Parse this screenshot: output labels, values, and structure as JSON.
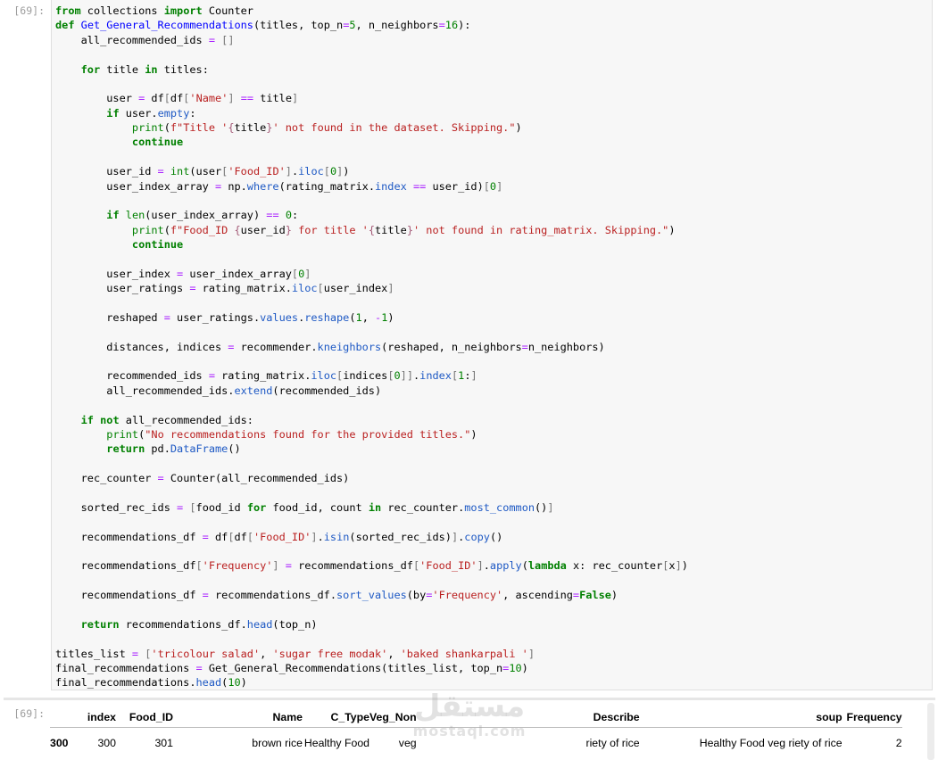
{
  "code_cell": {
    "prompt": "[69]:",
    "lines": [
      "from collections import Counter",
      "def Get_General_Recommendations(titles, top_n=5, n_neighbors=16):",
      "    all_recommended_ids = []",
      "",
      "    for title in titles:",
      "",
      "        user = df[df['Name'] == title]",
      "        if user.empty:",
      "            print(f\"Title '{title}' not found in the dataset. Skipping.\")",
      "            continue",
      "",
      "        user_id = int(user['Food_ID'].iloc[0])",
      "        user_index_array = np.where(rating_matrix.index == user_id)[0]",
      "",
      "        if len(user_index_array) == 0:",
      "            print(f\"Food_ID {user_id} for title '{title}' not found in rating_matrix. Skipping.\")",
      "            continue",
      "",
      "        user_index = user_index_array[0]",
      "        user_ratings = rating_matrix.iloc[user_index]",
      "",
      "        reshaped = user_ratings.values.reshape(1, -1)",
      "",
      "        distances, indices = recommender.kneighbors(reshaped, n_neighbors=n_neighbors)",
      "",
      "        recommended_ids = rating_matrix.iloc[indices[0]].index[1:]",
      "        all_recommended_ids.extend(recommended_ids)",
      "",
      "    if not all_recommended_ids:",
      "        print(\"No recommendations found for the provided titles.\")",
      "        return pd.DataFrame()",
      "",
      "    rec_counter = Counter(all_recommended_ids)",
      "",
      "    sorted_rec_ids = [food_id for food_id, count in rec_counter.most_common()]",
      "",
      "    recommendations_df = df[df['Food_ID'].isin(sorted_rec_ids)].copy()",
      "",
      "    recommendations_df['Frequency'] = recommendations_df['Food_ID'].apply(lambda x: rec_counter[x])",
      "",
      "    recommendations_df = recommendations_df.sort_values(by='Frequency', ascending=False)",
      "",
      "    return recommendations_df.head(top_n)",
      "",
      "titles_list = ['tricolour salad', 'sugar free modak', 'baked shankarpali ']",
      "final_recommendations = Get_General_Recommendations(titles_list, top_n=10)",
      "final_recommendations.head(10)"
    ]
  },
  "output_cell": {
    "prompt": "[69]:",
    "columns": [
      "",
      "index",
      "Food_ID",
      "Name",
      "C_Type",
      "Veg_Non",
      "Describe",
      "soup",
      "Frequency"
    ],
    "rows": [
      [
        "300",
        "300",
        "301",
        "brown rice",
        "Healthy Food",
        "veg",
        "riety of rice",
        "Healthy Food veg riety of rice",
        "2"
      ]
    ]
  },
  "watermark": {
    "arabic": "مستقل",
    "latin": "mostaql.com"
  }
}
